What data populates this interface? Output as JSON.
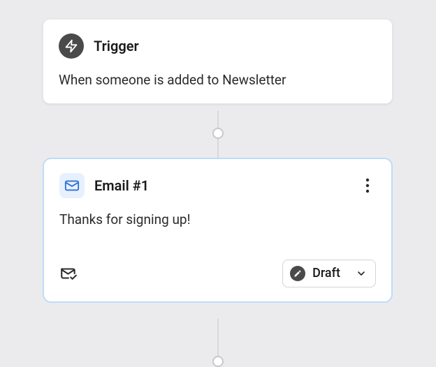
{
  "trigger": {
    "title": "Trigger",
    "description": "When someone is added to Newsletter"
  },
  "email": {
    "title": "Email #1",
    "subject": "Thanks for signing up!",
    "status": "Draft"
  },
  "icons": {
    "lightning": "lightning-icon",
    "mail": "mail-icon",
    "kebab": "more-icon",
    "mailCheck": "mail-check-icon",
    "pencil": "pencil-icon",
    "chevron": "chevron-down-icon"
  }
}
